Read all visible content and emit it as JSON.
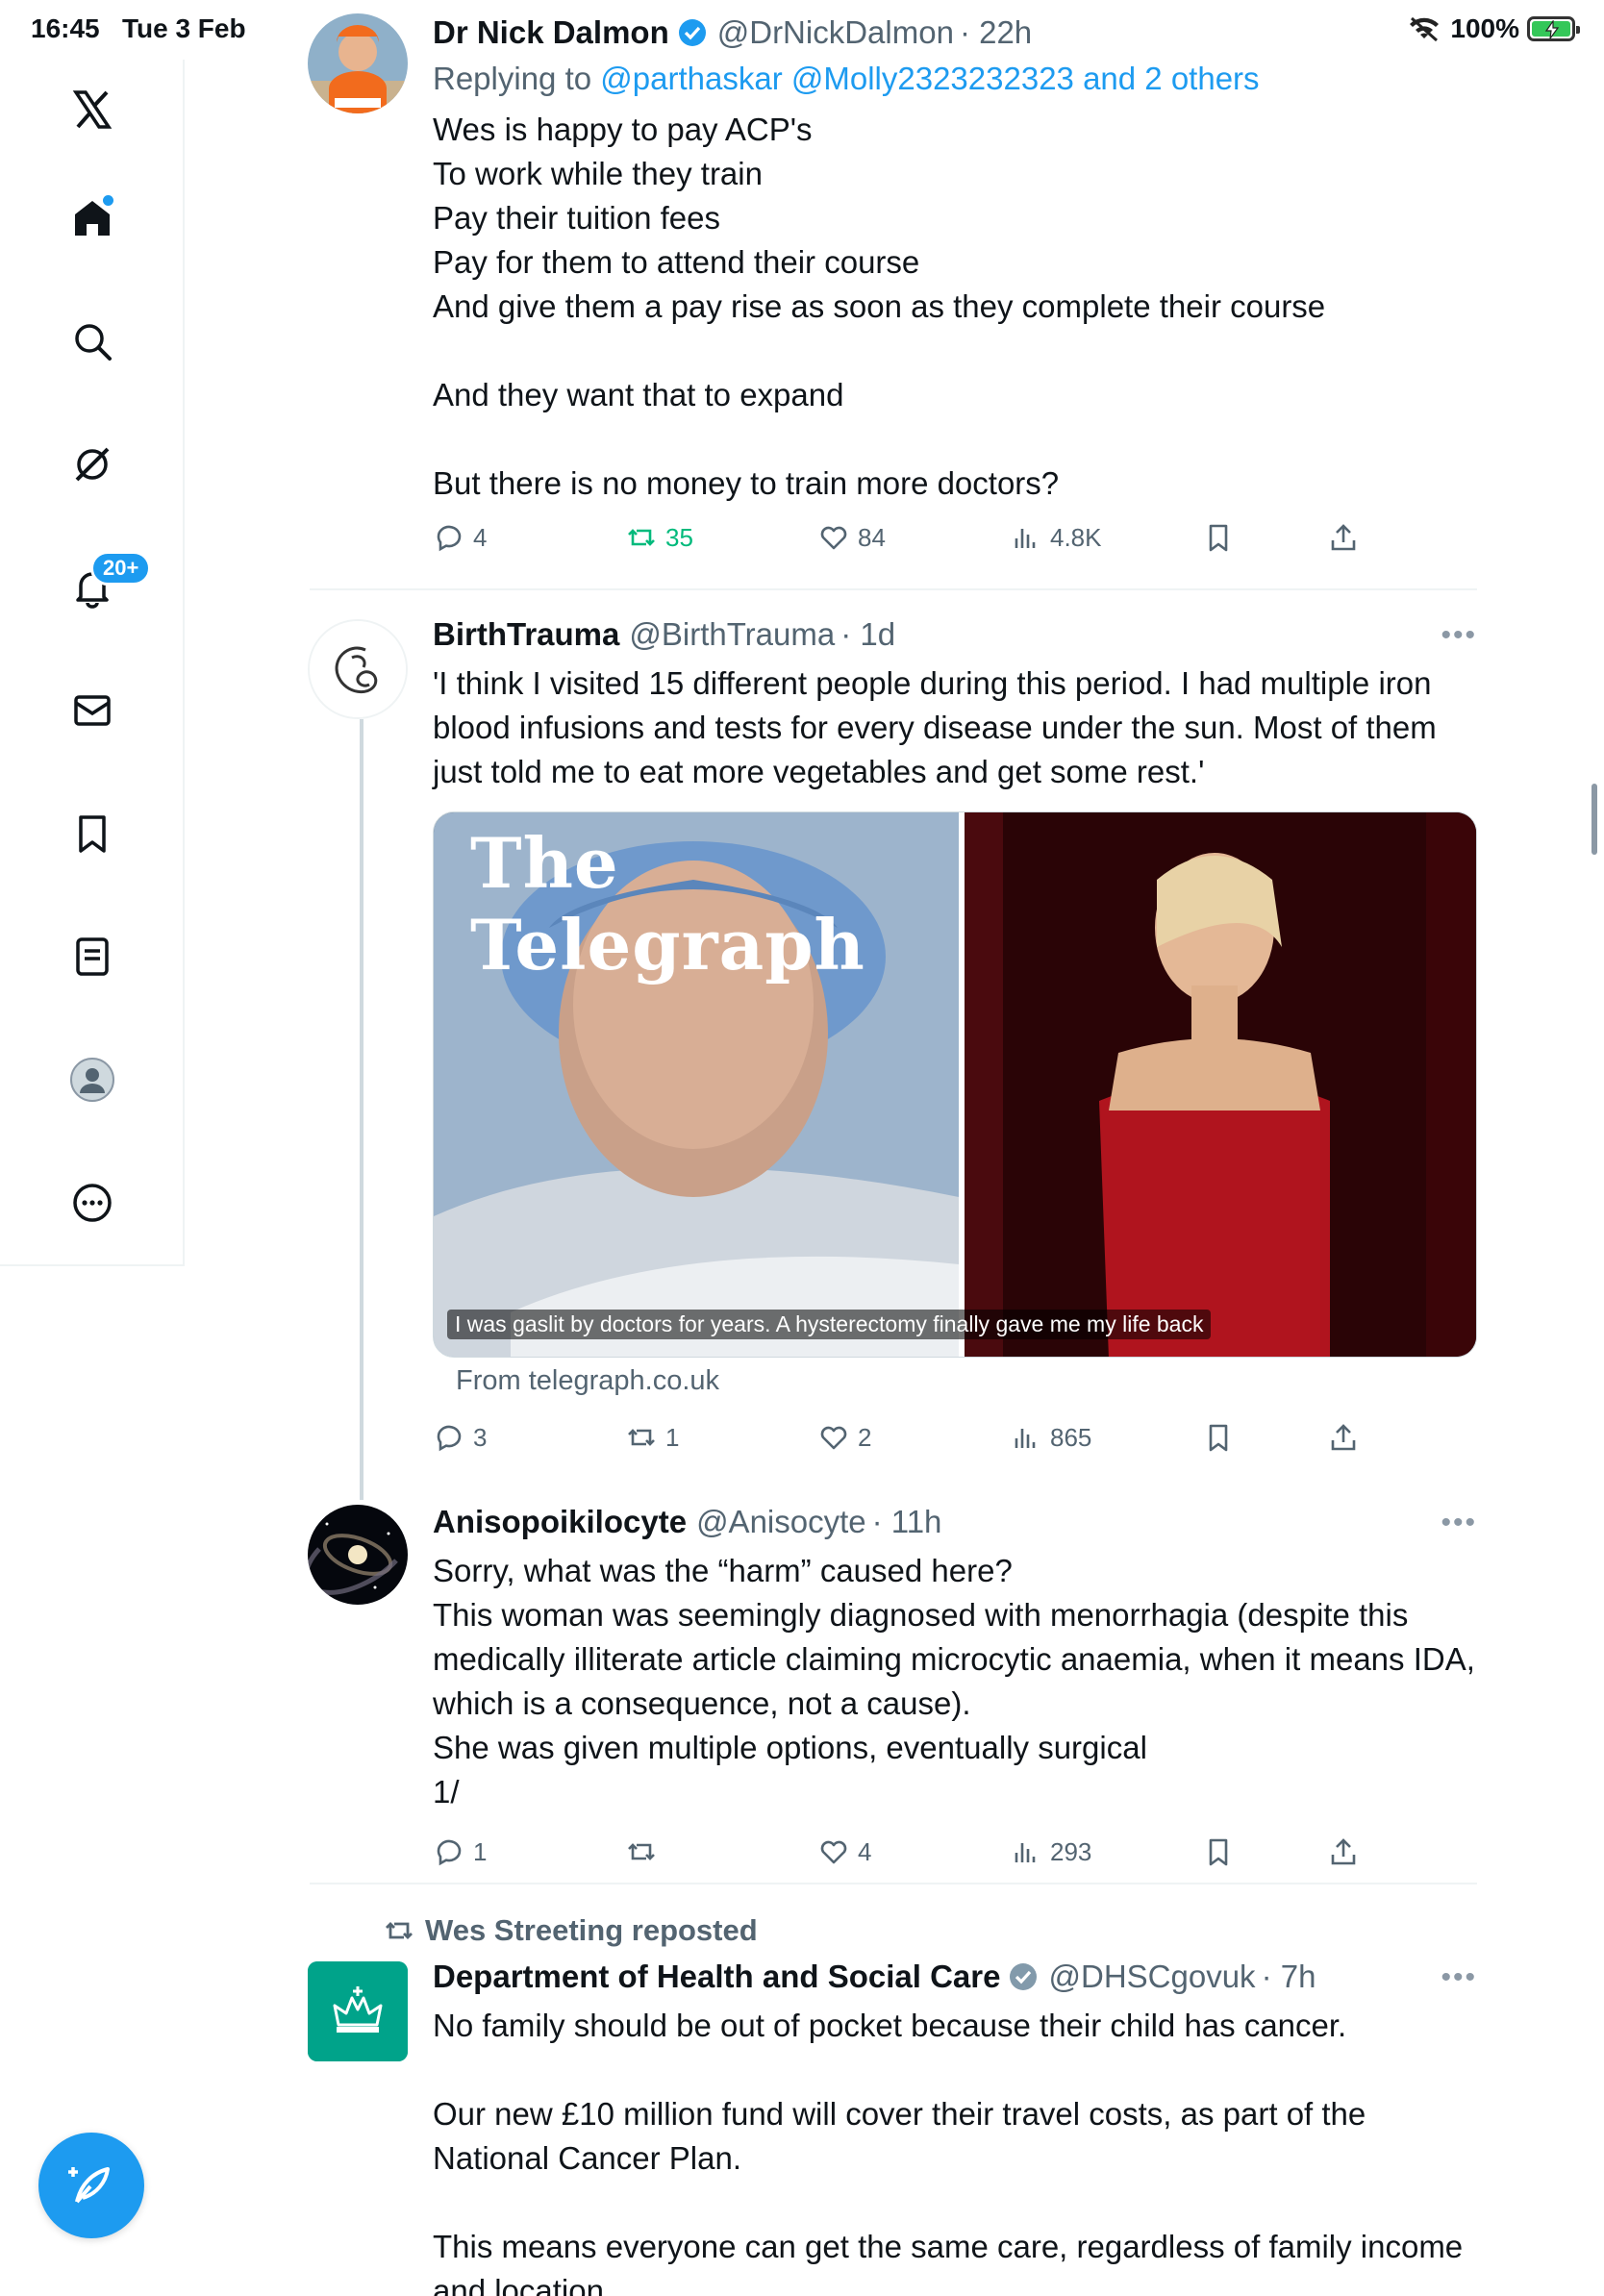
{
  "status_bar": {
    "time": "16:45",
    "date": "Tue 3 Feb",
    "battery": "100%"
  },
  "sidebar": {
    "items": [
      {
        "icon": "x-logo-icon"
      },
      {
        "icon": "home-icon"
      },
      {
        "icon": "search-icon"
      },
      {
        "icon": "grok-icon"
      },
      {
        "icon": "bell-icon",
        "badge": "20+"
      },
      {
        "icon": "mail-icon"
      },
      {
        "icon": "bookmark-icon"
      },
      {
        "icon": "lists-icon"
      },
      {
        "icon": "profile-icon"
      },
      {
        "icon": "more-icon"
      }
    ],
    "compose": "compose-icon"
  },
  "tweets": [
    {
      "name": "Dr Nick Dalmon",
      "handle": "@DrNickDalmon",
      "time": "· 22h",
      "replying_prefix": "Replying to",
      "replying_to": "@parthaskar @Molly2323232323 and 2 others",
      "text": "Wes is happy to pay ACP's\nTo work while they train\nPay their tuition fees\nPay for them to attend their course\nAnd give them a pay rise as soon as they complete their course\n\nAnd they want that to expand\n\nBut there is no money to train more doctors?",
      "replies": "4",
      "reposts": "35",
      "likes": "84",
      "views": "4.8K"
    },
    {
      "name": "BirthTrauma",
      "handle": "@BirthTrauma",
      "time": "· 1d",
      "text": "'I think I visited 15 different people during this period. I had multiple iron blood infusions and tests for every disease under the sun. Most of them just told me to eat more vegetables and get some rest.'",
      "card": {
        "masthead": "The Telegraph",
        "caption": "I was gaslit by doctors for years. A hysterectomy finally gave me my life back",
        "source": "From telegraph.co.uk"
      },
      "replies": "3",
      "reposts": "1",
      "likes": "2",
      "views": "865"
    },
    {
      "name": "Anisopoikilocyte",
      "handle": "@Anisocyte",
      "time": "· 11h",
      "text": "Sorry, what was the “harm” caused here?\nThis woman was seemingly diagnosed with menorrhagia (despite this medically illiterate article claiming microcytic anaemia, when it means IDA, which is a consequence, not a cause).\nShe was given multiple options, eventually surgical\n1/",
      "replies": "1",
      "reposts": "",
      "likes": "4",
      "views": "293"
    },
    {
      "repost_label": "Wes Streeting reposted",
      "name": "Department of Health and Social Care",
      "handle": "@DHSCgovuk",
      "time": "· 7h",
      "text": "No family should be out of pocket because their child has cancer.\n\nOur new £10 million fund will cover their travel costs, as part of the National Cancer Plan.\n\nThis means everyone can get the same care, regardless of family income and location."
    }
  ],
  "colors": {
    "accent": "#1d9bf0",
    "repost_green": "#00ba7c",
    "muted": "#536471",
    "dhsc_green": "#00a38a"
  }
}
